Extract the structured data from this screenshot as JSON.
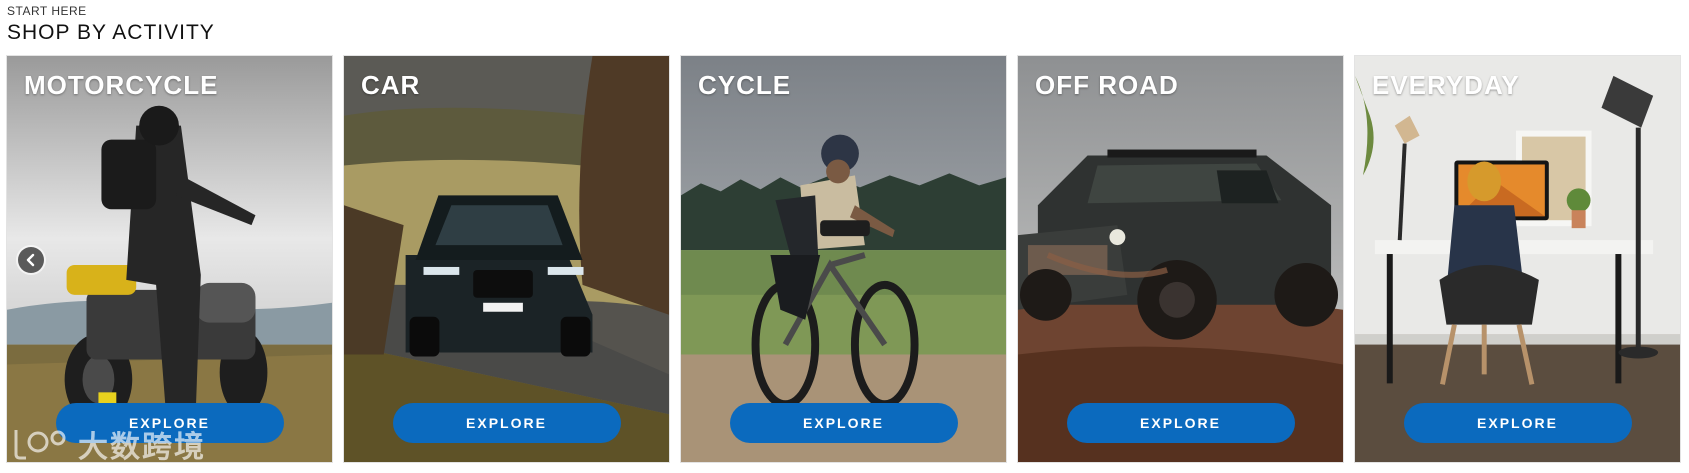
{
  "section": {
    "eyebrow": "START HERE",
    "title": "SHOP BY ACTIVITY"
  },
  "cards": [
    {
      "title": "MOTORCYCLE",
      "cta": "EXPLORE"
    },
    {
      "title": "CAR",
      "cta": "EXPLORE"
    },
    {
      "title": "CYCLE",
      "cta": "EXPLORE"
    },
    {
      "title": "OFF ROAD",
      "cta": "EXPLORE"
    },
    {
      "title": "EVERYDAY",
      "cta": "EXPLORE"
    }
  ],
  "carousel": {
    "prev_icon": "chevron-left-icon"
  },
  "watermark": {
    "text": "大数跨境"
  },
  "colors": {
    "button": "#0b6abe",
    "card_title": "#ffffff"
  }
}
